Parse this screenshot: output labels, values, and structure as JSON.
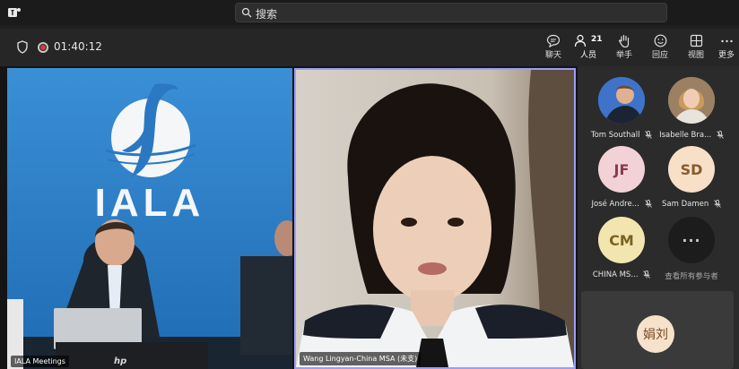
{
  "titlebar": {
    "search_placeholder": "搜索"
  },
  "meeting": {
    "timer": "01:40:12"
  },
  "toolbar": {
    "chat_label": "聊天",
    "people_label": "人员",
    "people_count": "21",
    "raise_hand_label": "举手",
    "react_label": "回应",
    "view_label": "视图",
    "more_label": "更多"
  },
  "stage": {
    "left_tile_name": "IALA Meetings",
    "left_logo_text": "IALA",
    "laptop_brand": "hp",
    "right_tile_name": "Wang Lingyan-China MSA (未支)"
  },
  "participants": [
    {
      "name": "Tom Southall",
      "initials": ""
    },
    {
      "name": "Isabelle Bra...",
      "initials": ""
    },
    {
      "name": "José Andre...",
      "initials": "JF",
      "color": "#f2d2d6",
      "text_color": "#8a3b4c"
    },
    {
      "name": "Sam Damen",
      "initials": "SD",
      "color": "#f7dfc8",
      "text_color": "#8a5a2b"
    },
    {
      "name": "CHINA MS...",
      "initials": "CM",
      "color": "#f3e5b0",
      "text_color": "#7a6320"
    },
    {
      "name": "查看所有参与者",
      "initials": "···"
    }
  ],
  "bottom_card": {
    "initials": "娟刘"
  }
}
